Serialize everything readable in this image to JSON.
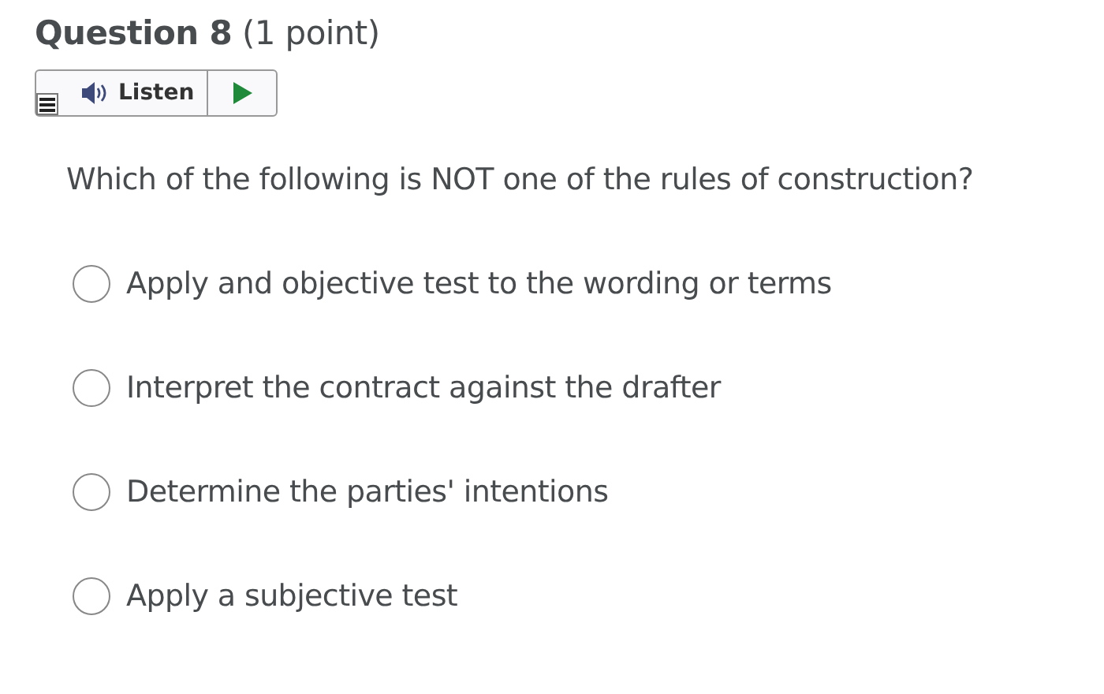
{
  "title": "**Question 8** (1 point)",
  "listen": {
    "label": "Listen"
  },
  "question": "Which of the following is NOT one of the rules of construction?",
  "options": [
    {
      "label": "Apply and objective test to the wording or terms",
      "selected": false
    },
    {
      "label": "Interpret the contract against the drafter",
      "selected": false
    },
    {
      "label": "Determine the parties' intentions",
      "selected": false
    },
    {
      "label": "Apply a subjective test",
      "selected": false
    }
  ]
}
